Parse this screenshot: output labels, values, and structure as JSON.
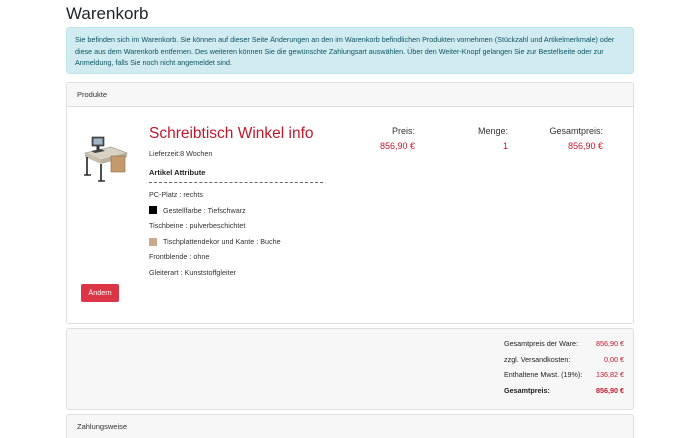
{
  "page": {
    "title": "Warenkorb",
    "info": "Sie befinden sich im Warenkorb. Sie können auf dieser Seite Änderungen an den im Warenkorb befindlichen Produkten vornehmen (Stückzahl und Artikelmerkmale) oder diese aus dem Warenkorb entfernen. Des weiteren können Sie die gewünschte Zahlungsart auswählen. Über den Weiter-Knopf gelangen Sie zur Bestellseite oder zur Anmeldung, falls Sie noch nicht angemeldet sind."
  },
  "products": {
    "header": "Produkte",
    "item": {
      "name": "Schreibtisch Winkel info",
      "delivery": "Lieferzeit:8 Wochen",
      "attributes_heading": "Artikel Attribute",
      "attributes": [
        {
          "text": "PC-Platz : rechts"
        },
        {
          "text": "Gestellfarbe : Tiefschwarz",
          "swatch": "#000000"
        },
        {
          "text": "Tischbeine : pulverbeschichtet"
        },
        {
          "text": "Tischplattendekor und Kante : Buche",
          "swatch": "#c9a98a"
        },
        {
          "text": "Frontblende : ohne"
        },
        {
          "text": "Gleiterart : Kunststoffgleiter"
        }
      ],
      "price_label": "Preis:",
      "price": "856,90 €",
      "quantity_label": "Menge:",
      "quantity": "1",
      "total_label": "Gesamtpreis:",
      "total": "856,90 €",
      "change_button": "Ändern"
    }
  },
  "totals": {
    "rows": [
      {
        "label": "Gesamtpreis der Ware:",
        "value": "856,90 €"
      },
      {
        "label": "zzgl. Versandkosten:",
        "value": "0,00 €"
      },
      {
        "label": "Enthaltene Mwst. (19%):",
        "value": "136,82 €"
      },
      {
        "label": "Gesamtpreis:",
        "value": "856,90 €"
      }
    ]
  },
  "payment": {
    "header": "Zahlungsweise"
  },
  "colors": {
    "accent_red": "#c2172b",
    "button_red": "#dc3545",
    "info_bg": "#d1ecf1"
  }
}
